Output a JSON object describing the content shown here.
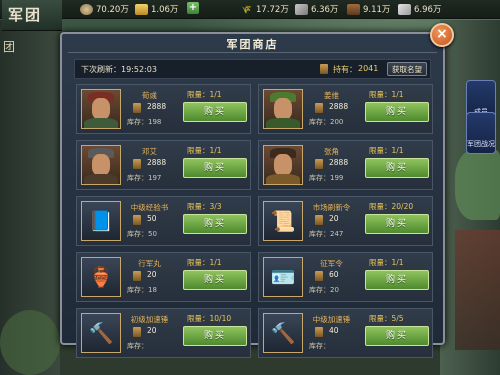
{
  "header": {
    "corner_title": "军团",
    "side_label": "团"
  },
  "resources": [
    {
      "icon": "coin-icon",
      "value": "70.20万"
    },
    {
      "icon": "gold-ingot-icon",
      "value": "1.06万"
    },
    {
      "icon": "grain-icon",
      "value": "17.72万"
    },
    {
      "icon": "iron-icon",
      "value": "6.36万"
    },
    {
      "icon": "wood-icon",
      "value": "9.11万"
    },
    {
      "icon": "stone-icon",
      "value": "6.96万"
    }
  ],
  "side_buttons": [
    {
      "label": "成员"
    },
    {
      "label": "军团战况"
    }
  ],
  "shop": {
    "title": "军团商店",
    "refresh_text": "下次刷新：19:52:03",
    "owned_label": "持有：",
    "owned_value": "2041",
    "get_button": "获取名望",
    "buy_label": "购买",
    "stock_prefix": "库存：",
    "limit_prefix": "限量："
  },
  "items": [
    {
      "name": "荀彧",
      "price": "2888",
      "stock": "198",
      "limit": "1/1",
      "kind": "hero",
      "hat": "#7a2d22",
      "robe": "#3f5b3a"
    },
    {
      "name": "姜维",
      "price": "2888",
      "stock": "200",
      "limit": "1/1",
      "kind": "hero",
      "hat": "#4c7a2f",
      "robe": "#395a2a"
    },
    {
      "name": "邓艾",
      "price": "2888",
      "stock": "197",
      "limit": "1/1",
      "kind": "hero",
      "hat": "#5a5a5a",
      "robe": "#4b3b2b"
    },
    {
      "name": "张角",
      "price": "2888",
      "stock": "199",
      "limit": "1/1",
      "kind": "hero",
      "hat": "#3a2b1e",
      "robe": "#7a5a2b"
    },
    {
      "name": "中级经验书",
      "price": "50",
      "stock": "50",
      "limit": "3/3",
      "kind": "item",
      "glyph": "📘"
    },
    {
      "name": "市场刷新令",
      "price": "20",
      "stock": "247",
      "limit": "20/20",
      "kind": "item",
      "glyph": "📜"
    },
    {
      "name": "行军丸",
      "price": "20",
      "stock": "18",
      "limit": "1/1",
      "kind": "item",
      "glyph": "🏺"
    },
    {
      "name": "征军令",
      "price": "60",
      "stock": "20",
      "limit": "1/1",
      "kind": "item",
      "glyph": "🪪"
    },
    {
      "name": "初级加速锤",
      "price": "20",
      "stock": "",
      "limit": "10/10",
      "kind": "item",
      "glyph": "🔨"
    },
    {
      "name": "中级加速锤",
      "price": "40",
      "stock": "",
      "limit": "5/5",
      "kind": "item",
      "glyph": "🔨"
    }
  ]
}
